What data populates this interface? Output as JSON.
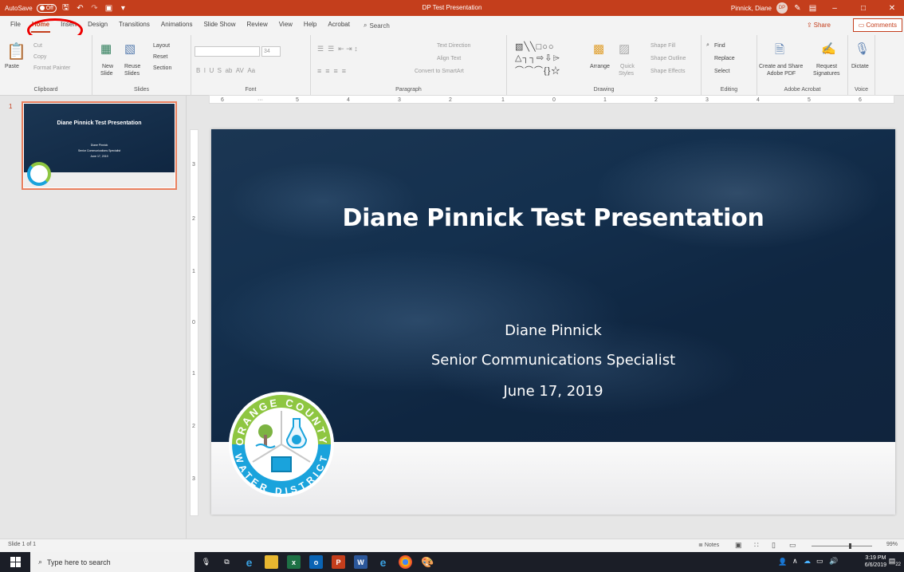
{
  "titlebar": {
    "autosave_label": "AutoSave",
    "autosave_state": "Off",
    "document_title": "DP Test Presentation",
    "user_name": "Pinnick, Diane",
    "user_initials": "DP"
  },
  "tabs": [
    "File",
    "Home",
    "Insert",
    "Design",
    "Transitions",
    "Animations",
    "Slide Show",
    "Review",
    "View",
    "Help",
    "Acrobat"
  ],
  "search_label": "Search",
  "share_label": "Share",
  "comments_label": "Comments",
  "ribbon": {
    "clipboard": {
      "paste": "Paste",
      "cut": "Cut",
      "copy": "Copy",
      "format_painter": "Format Painter",
      "label": "Clipboard"
    },
    "slides": {
      "new_slide_1": "New",
      "new_slide_2": "Slide",
      "reuse_1": "Reuse",
      "reuse_2": "Slides",
      "layout": "Layout",
      "reset": "Reset",
      "section": "Section",
      "label": "Slides"
    },
    "font": {
      "size": "34",
      "label": "Font"
    },
    "paragraph": {
      "text_direction": "Text Direction",
      "align_text": "Align Text",
      "convert": "Convert to SmartArt",
      "label": "Paragraph"
    },
    "drawing": {
      "arrange": "Arrange",
      "quick_styles_1": "Quick",
      "quick_styles_2": "Styles",
      "shape_fill": "Shape Fill",
      "shape_outline": "Shape Outline",
      "shape_effects": "Shape Effects",
      "label": "Drawing"
    },
    "editing": {
      "find": "Find",
      "replace": "Replace",
      "select": "Select",
      "label": "Editing"
    },
    "acrobat": {
      "create_share_1": "Create and Share",
      "create_share_2": "Adobe PDF",
      "request_1": "Request",
      "request_2": "Signatures",
      "label": "Adobe Acrobat"
    },
    "voice": {
      "dictate": "Dictate",
      "label": "Voice"
    }
  },
  "thumbnail": {
    "number": "1"
  },
  "slide": {
    "title": "Diane Pinnick Test Presentation",
    "name": "Diane Pinnick",
    "role": "Senior Communications Specialist",
    "date": "June 17, 2019",
    "logo_text_top": "ORANGE COUNTY",
    "logo_text_bottom": "WATER DISTRICT"
  },
  "status": {
    "slide_info": "Slide 1 of 1",
    "notes": "Notes",
    "zoom": "99%",
    "zoom_fraction": 0.62
  },
  "taskbar": {
    "search_placeholder": "Type here to search",
    "time": "3:19 PM",
    "date": "6/6/2019",
    "notification_count": "22"
  },
  "colors": {
    "accent": "#c43e1c",
    "slide_bg": "#14304e",
    "logo_green": "#8ec641",
    "logo_blue": "#1aa3dc"
  }
}
